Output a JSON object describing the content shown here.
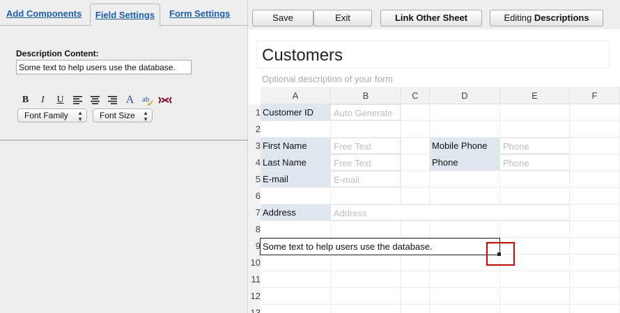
{
  "tabs": [
    {
      "label": "Add Components"
    },
    {
      "label": "Field Settings"
    },
    {
      "label": "Form Settings"
    }
  ],
  "field_settings": {
    "description_label": "Description Content:",
    "description_value": "Some text to help users use the database.",
    "format_buttons": [
      "B",
      "I",
      "U",
      "align-left-icon",
      "align-center-icon",
      "align-right-icon",
      "A",
      "spellcheck-icon",
      "unlink-icon"
    ],
    "font_family": "Font Family",
    "font_size": "Font Size"
  },
  "toolbar": {
    "save": "Save",
    "exit": "Exit",
    "link_other_sheet": "Link Other Sheet",
    "editing_prefix": "Editing",
    "editing_mode": "Descriptions"
  },
  "form": {
    "title": "Customers",
    "description_placeholder": "Optional description of your form"
  },
  "grid": {
    "columns": [
      "A",
      "B",
      "C",
      "D",
      "E",
      "F"
    ],
    "rows": [
      "1",
      "2",
      "3",
      "4",
      "5",
      "6",
      "7",
      "8",
      "9",
      "10",
      "11",
      "12",
      "13"
    ],
    "fields": {
      "customer_id": {
        "label": "Customer ID",
        "placeholder": "Auto Generate"
      },
      "first_name": {
        "label": "First Name",
        "placeholder": "Free Text"
      },
      "last_name": {
        "label": "Last Name",
        "placeholder": "Free Text"
      },
      "email": {
        "label": "E-mail",
        "placeholder": "E-mail"
      },
      "mobile_phone": {
        "label": "Mobile Phone",
        "placeholder": "Phone"
      },
      "phone": {
        "label": "Phone",
        "placeholder": "Phone"
      },
      "address": {
        "label": "Address",
        "placeholder": "Address"
      }
    },
    "description_cell": "Some text to help users use the database."
  },
  "colors": {
    "tab_link": "#1a5fb4",
    "label_bg": "#dfe6ee",
    "highlight": "#e00000"
  }
}
